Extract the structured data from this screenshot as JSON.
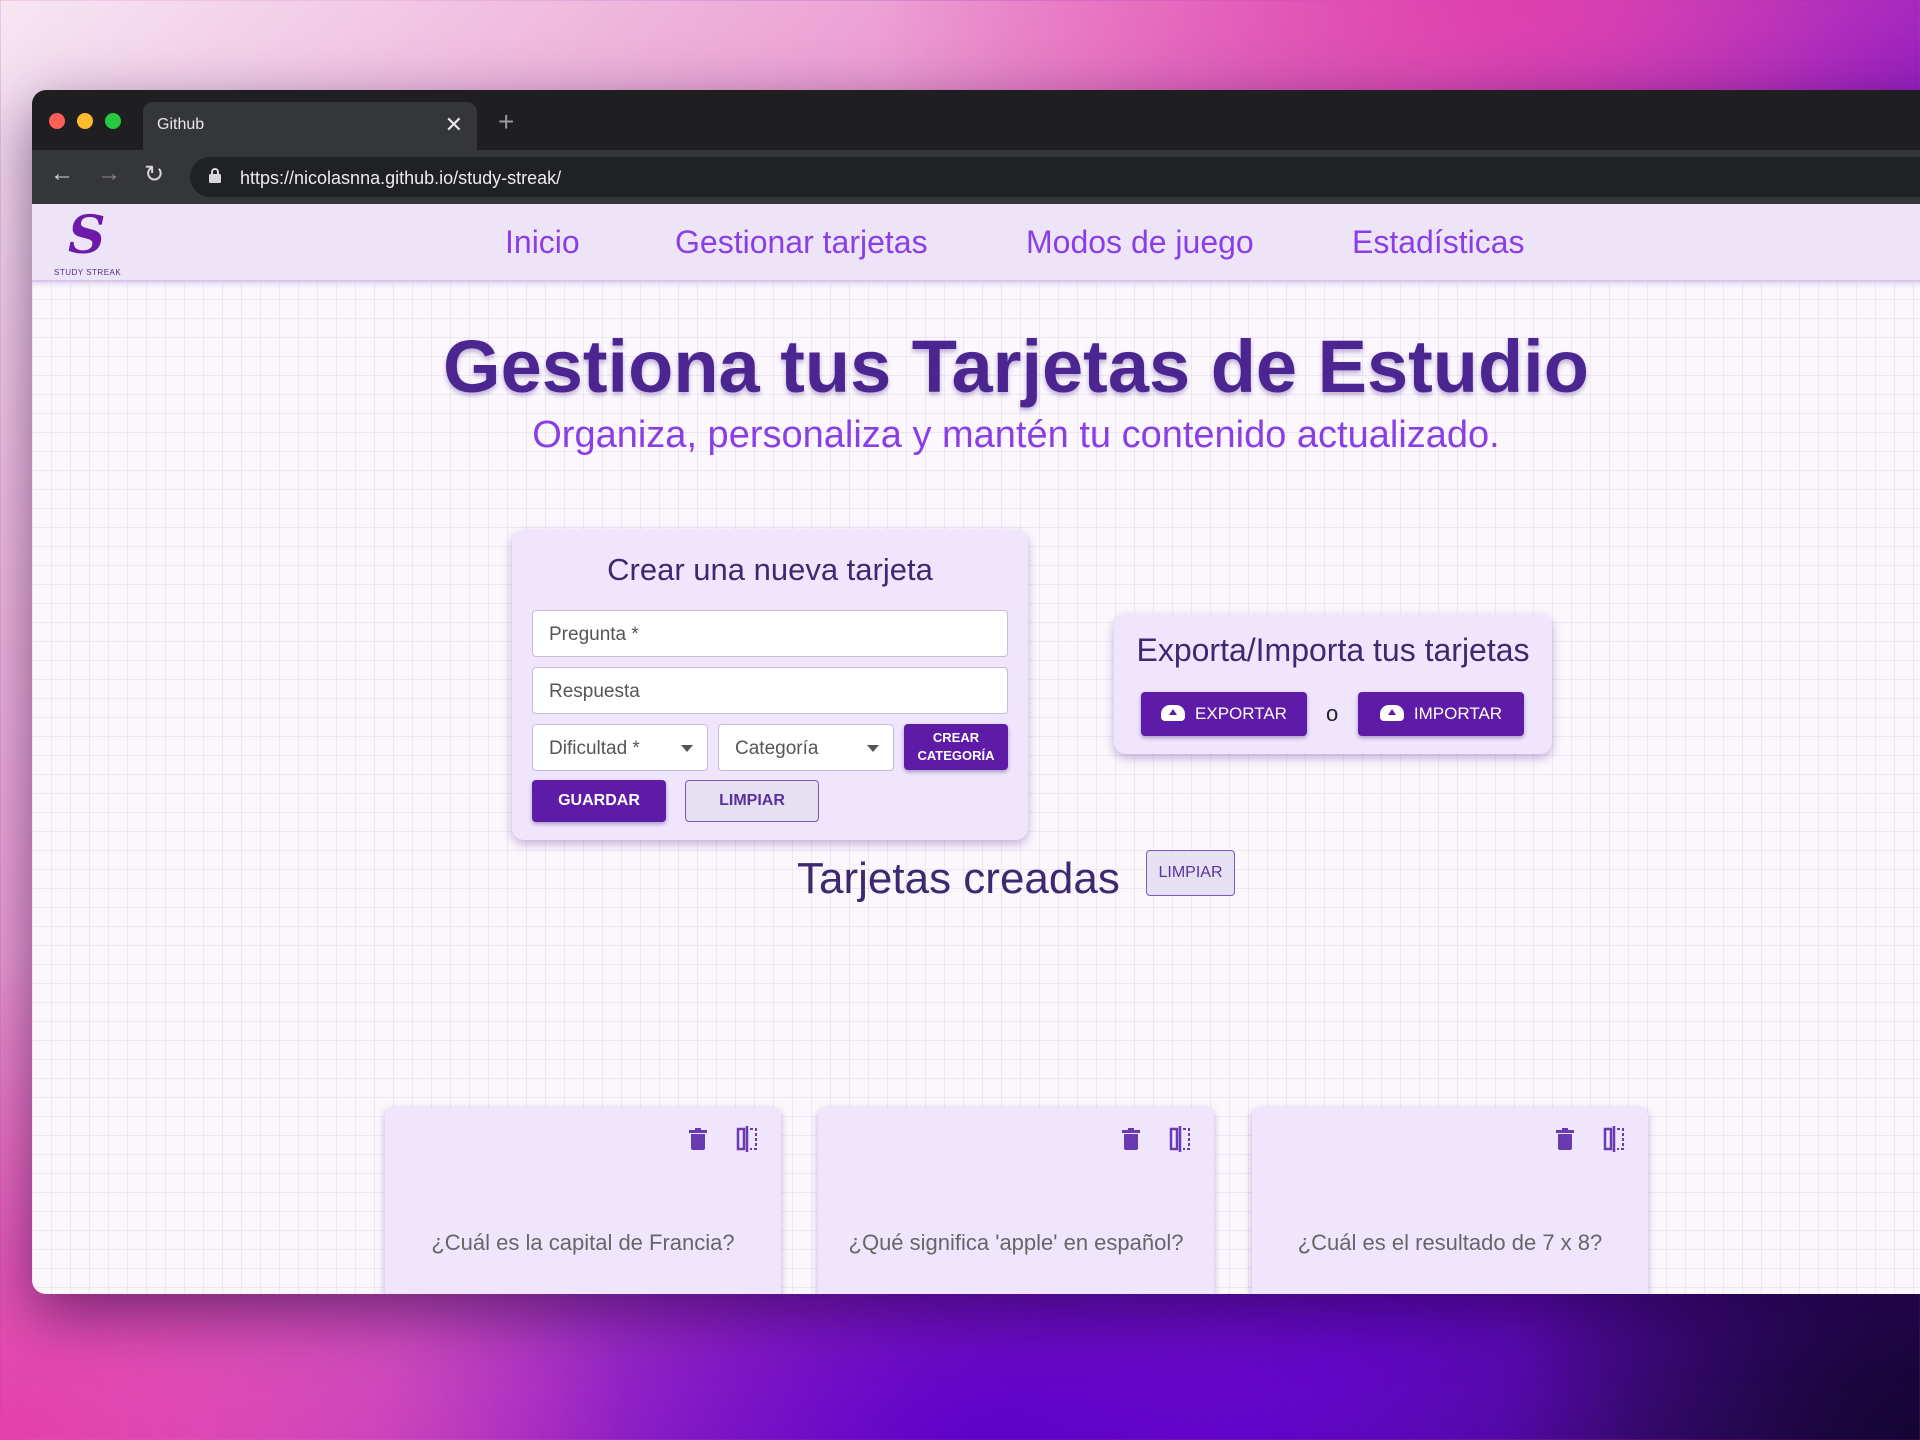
{
  "browser": {
    "tab_title": "Github",
    "tab_close": "✕",
    "new_tab": "+",
    "url": "https://nicolasnna.github.io/study-streak/"
  },
  "navbar": {
    "logo_text": "STUDY STREAK",
    "links": [
      "Inicio",
      "Gestionar tarjetas",
      "Modos de juego",
      "Estadísticas"
    ]
  },
  "header": {
    "title": "Gestiona tus Tarjetas de Estudio",
    "subtitle": "Organiza, personaliza y mantén tu contenido actualizado."
  },
  "create_form": {
    "title": "Crear una nueva tarjeta",
    "question_placeholder": "Pregunta *",
    "answer_placeholder": "Respuesta",
    "difficulty_label": "Dificultad *",
    "category_label": "Categoría",
    "create_category_button": "CREAR CATEGORÍA",
    "save_button": "GUARDAR",
    "clear_button": "LIMPIAR"
  },
  "import_export": {
    "title": "Exporta/Importa tus tarjetas",
    "export_button": "EXPORTAR",
    "separator": "o",
    "import_button": "IMPORTAR"
  },
  "cards_section": {
    "title": "Tarjetas creadas",
    "clear_button": "LIMPIAR",
    "cards": [
      {
        "question": "¿Cuál es la capital de Francia?"
      },
      {
        "question": "¿Qué significa 'apple' en español?"
      },
      {
        "question": "¿Cuál es el resultado de 7 x 8?"
      }
    ]
  },
  "colors": {
    "accent": "#5e1ba8",
    "nav_link": "#8b3ee6",
    "title": "#4b2590",
    "card_bg": "#efe6fd"
  }
}
